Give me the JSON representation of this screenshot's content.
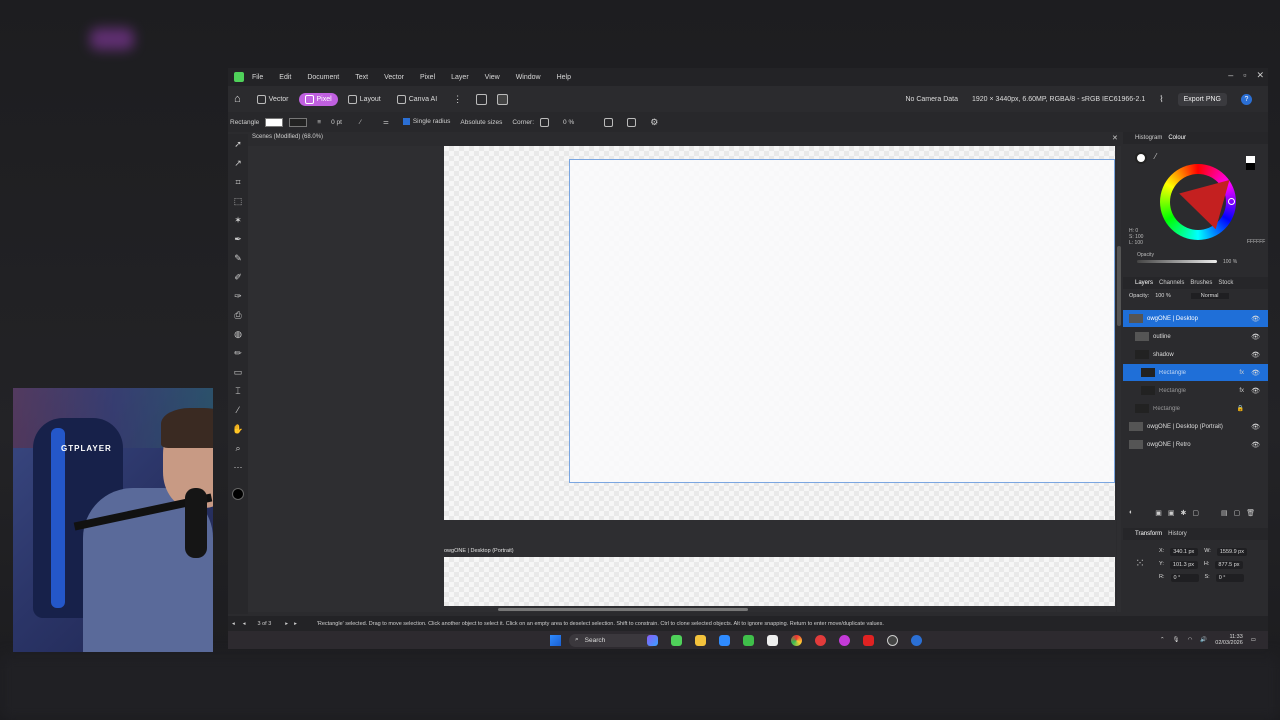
{
  "menu": [
    "File",
    "Edit",
    "Document",
    "Text",
    "Vector",
    "Pixel",
    "Layer",
    "View",
    "Window",
    "Help"
  ],
  "toolbar": {
    "personas": [
      "Vector",
      "Pixel",
      "Layout",
      "Canva AI"
    ],
    "active_persona": "Pixel",
    "camera": "No Camera Data",
    "doc_info": "1920 × 3440px, 6.60MP, RGBA/8 - sRGB IEC61966-2.1",
    "export": "Export PNG"
  },
  "context": {
    "tool": "Rectangle",
    "stroke_width": "0 pt",
    "single_radius": "Single radius",
    "absolute_sizes": "Absolute sizes",
    "corner": "Corner:",
    "corner_pct": "0 %"
  },
  "document": {
    "tab": "Scenes (Modified) (68.0%)",
    "artboard2_label": "owgONE | Desktop (Portrait)"
  },
  "status": {
    "page": "3 of 3",
    "hint": "'Rectangle' selected. Drag to move selection. Click another object to select it. Click on an empty area to deselect selection. Shift to constrain. Ctrl to clone selected objects. Alt to ignore snapping. Return to enter move/duplicate values."
  },
  "color_panel": {
    "tabs": [
      "Histogram",
      "Colour"
    ],
    "hex": "FFFFFF",
    "hsl": [
      "H: 0",
      "S: 100",
      "L: 100"
    ],
    "opacity_label": "Opacity",
    "opacity": "100 %"
  },
  "layers_panel": {
    "tabs": [
      "Layers",
      "Channels",
      "Brushes",
      "Stock"
    ],
    "opacity_label": "Opacity:",
    "opacity": "100 %",
    "blend": "Normal",
    "layers": [
      {
        "name": "owgONE | Desktop",
        "selected": true,
        "indent": 0
      },
      {
        "name": "outline",
        "selected": false,
        "indent": 1
      },
      {
        "name": "shadow",
        "selected": false,
        "indent": 1
      },
      {
        "name": "Rectangle",
        "selected": true,
        "indent": 2,
        "fx": true
      },
      {
        "name": "Rectangle",
        "selected": false,
        "indent": 2,
        "fx": true
      },
      {
        "name": "Rectangle",
        "selected": false,
        "indent": 1,
        "locked": true
      },
      {
        "name": "owgONE | Desktop (Portrait)",
        "selected": false,
        "indent": 0
      },
      {
        "name": "owgONE | Retro",
        "selected": false,
        "indent": 0
      }
    ]
  },
  "transform_panel": {
    "tabs": [
      "Transform",
      "History"
    ],
    "x": "340.1 px",
    "y": "101.3 px",
    "w": "1559.9 px",
    "h": "877.5 px",
    "r": "0 °",
    "s": "0 °"
  },
  "taskbar": {
    "search": "Search",
    "time": "11:33",
    "date": "02/03/2026"
  },
  "webcam": {
    "chair_text": "GTPLAYER"
  }
}
